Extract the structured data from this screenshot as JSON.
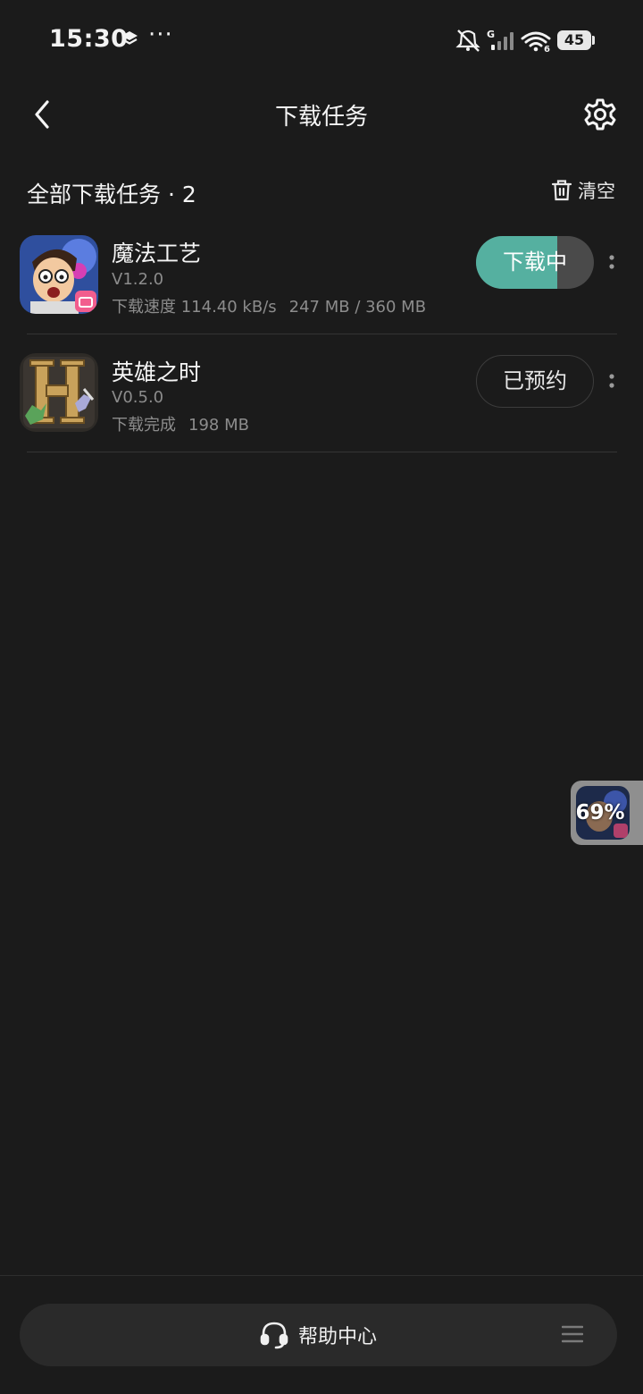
{
  "status_bar": {
    "time": "15:30",
    "more": "···",
    "battery": "45",
    "network_label": "G",
    "wifi_label": "6",
    "icons": [
      "layers-icon",
      "mute-bell-icon",
      "signal-icon",
      "wifi-icon",
      "battery-icon"
    ]
  },
  "header": {
    "title": "下载任务"
  },
  "section": {
    "title": "全部下载任务 · 2",
    "clear_label": "清空"
  },
  "tasks": [
    {
      "name": "魔法工艺",
      "version": "V1.2.0",
      "status_text": "下载速度 114.40 kB/s",
      "size_text": "247 MB / 360 MB",
      "action_label": "下载中",
      "progress": 0.686
    },
    {
      "name": "英雄之时",
      "version": "V0.5.0",
      "status_text": "下载完成",
      "size_text": "198 MB",
      "action_label": "已预约"
    }
  ],
  "float_widget": {
    "percent": "69%"
  },
  "footer": {
    "help_label": "帮助中心"
  },
  "colors": {
    "background": "#1b1b1b",
    "accent_teal": "#55b0a0",
    "text_secondary": "#8c8c8c"
  }
}
